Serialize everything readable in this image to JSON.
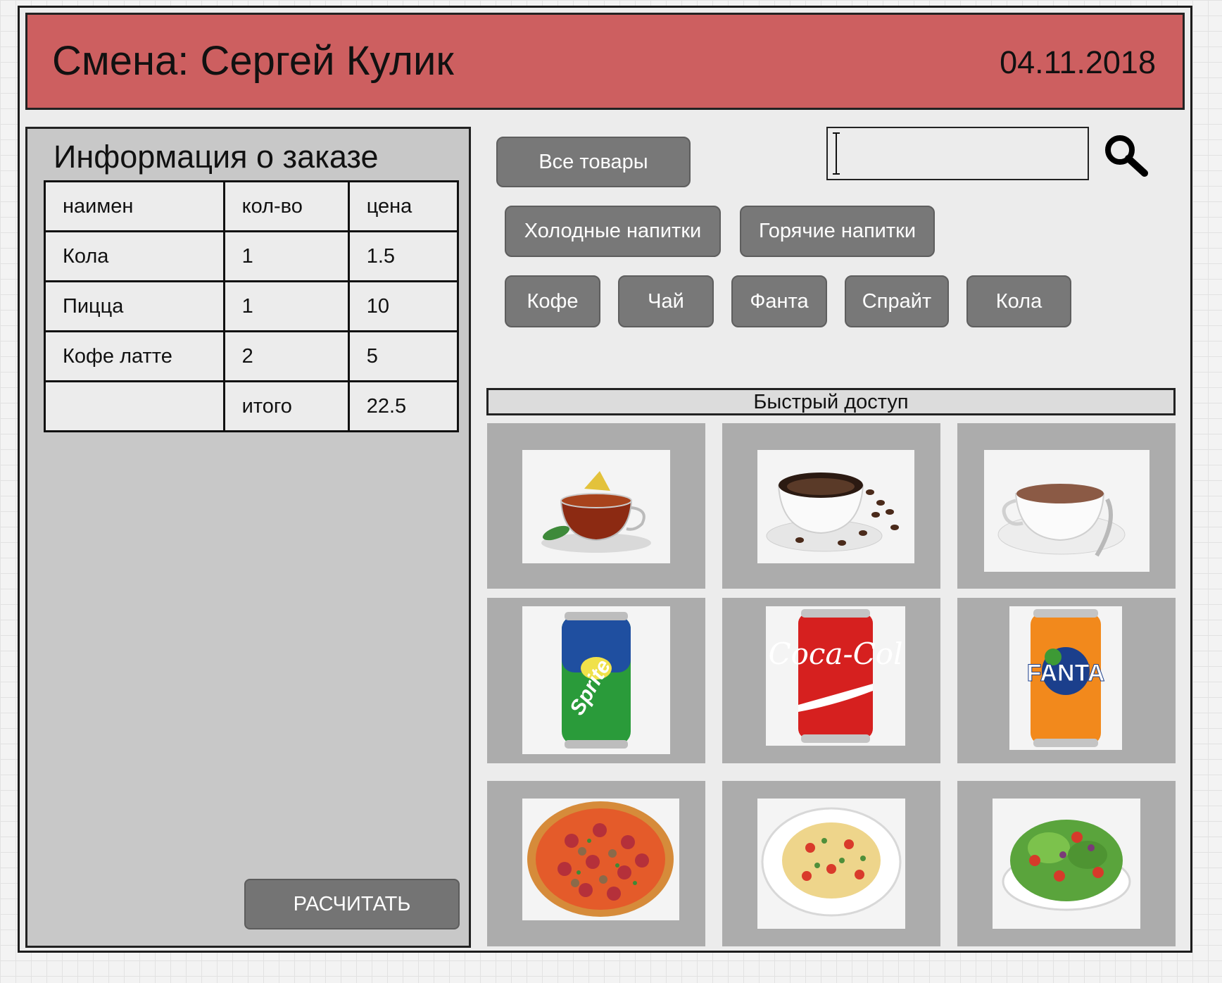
{
  "header": {
    "title": "Смена: Сергей Кулик",
    "date": "04.11.2018"
  },
  "order": {
    "title": "Информация о заказе",
    "columns": [
      "наимен",
      "кол-во",
      "цена"
    ],
    "rows": [
      [
        "Кола",
        "1",
        "1.5"
      ],
      [
        "Пицца",
        "1",
        "10"
      ],
      [
        "Кофе латте",
        "2",
        "5"
      ]
    ],
    "total_label": "итого",
    "total_value": "22.5",
    "calc_button": "РАСЧИТАТЬ"
  },
  "categories": {
    "all": "Все товары",
    "cold": "Холодные напитки",
    "hot": "Горячие напитки",
    "items": [
      "Кофе",
      "Чай",
      "Фанта",
      "Спрайт",
      "Кола"
    ]
  },
  "search": {
    "value": "",
    "icon": "search-icon"
  },
  "quick_access": {
    "title": "Быстрый доступ",
    "tiles": [
      "tea-cup-image",
      "black-coffee-image",
      "hot-chocolate-image",
      "sprite-can-image",
      "coca-cola-can-image",
      "fanta-can-image",
      "pizza-image",
      "pasta-image",
      "salad-image"
    ]
  },
  "colors": {
    "header_bg": "#cd5f60",
    "button_bg": "#787878",
    "panel_bg": "#c8c8c8",
    "tile_bg": "#acacac"
  }
}
